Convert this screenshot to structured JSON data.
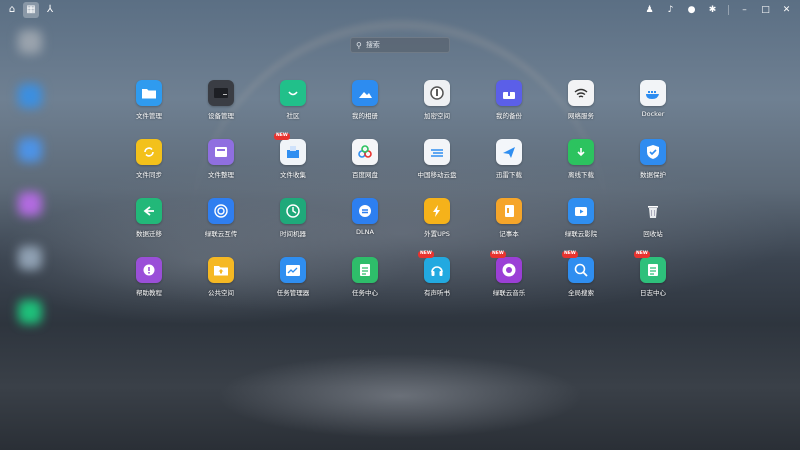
{
  "topbar": {
    "left_buttons": [
      {
        "icon": "home-icon",
        "glyph": "⌂"
      },
      {
        "icon": "grid-icon",
        "glyph": "▦"
      },
      {
        "icon": "network-icon",
        "glyph": "⅄"
      }
    ],
    "right_buttons": [
      {
        "icon": "mic-icon",
        "glyph": "♟"
      },
      {
        "icon": "bell-icon",
        "glyph": "♪"
      },
      {
        "icon": "user-icon",
        "glyph": "●"
      },
      {
        "icon": "gear-icon",
        "glyph": "✱"
      },
      {
        "icon": "minimize-icon",
        "glyph": "–"
      },
      {
        "icon": "maximize-icon",
        "glyph": "□"
      },
      {
        "icon": "close-icon",
        "glyph": "✕"
      }
    ]
  },
  "search": {
    "placeholder": "搜索",
    "icon": "search-icon",
    "glyph": "⚲"
  },
  "apps": [
    {
      "label": "文件管理",
      "icon": "folder-icon",
      "color": "#2f9bef",
      "badge": ""
    },
    {
      "label": "设备管理",
      "icon": "device-icon",
      "color": "#3a3d44",
      "badge": ""
    },
    {
      "label": "社区",
      "icon": "community-icon",
      "color": "#21c08a",
      "badge": ""
    },
    {
      "label": "我的相册",
      "icon": "photo-icon",
      "color": "#2d8cf0",
      "badge": ""
    },
    {
      "label": "加密空间",
      "icon": "safe-icon",
      "color": "#eef0f3",
      "badge": ""
    },
    {
      "label": "我的备份",
      "icon": "backup-icon",
      "color": "#5b5fe8",
      "badge": ""
    },
    {
      "label": "网络服务",
      "icon": "wifi-icon",
      "color": "#f2f3f5",
      "badge": ""
    },
    {
      "label": "Docker",
      "icon": "docker-icon",
      "color": "#f2f4f7",
      "badge": ""
    },
    {
      "label": "文件同步",
      "icon": "sync-icon",
      "color": "#f3c11b",
      "badge": ""
    },
    {
      "label": "文件整理",
      "icon": "organize-icon",
      "color": "#8f6fe0",
      "badge": ""
    },
    {
      "label": "文件收集",
      "icon": "collect-icon",
      "color": "#f0f4f8",
      "badge": "NEW"
    },
    {
      "label": "百度网盘",
      "icon": "baidu-icon",
      "color": "#f5f6f8",
      "badge": ""
    },
    {
      "label": "中国移动云盘",
      "icon": "cloud-icon",
      "color": "#f3f5f8",
      "badge": ""
    },
    {
      "label": "迅雷下载",
      "icon": "thunder-icon",
      "color": "#f3f6fa",
      "badge": ""
    },
    {
      "label": "离线下载",
      "icon": "download-icon",
      "color": "#2cc35f",
      "badge": ""
    },
    {
      "label": "数据保护",
      "icon": "shield-icon",
      "color": "#2f8cf0",
      "badge": ""
    },
    {
      "label": "数据迁移",
      "icon": "migrate-icon",
      "color": "#22b879",
      "badge": ""
    },
    {
      "label": "绿联云互传",
      "icon": "transfer-icon",
      "color": "#2f7ef0",
      "badge": ""
    },
    {
      "label": "时间机器",
      "icon": "clock-icon",
      "color": "#1fa97a",
      "badge": ""
    },
    {
      "label": "DLNA",
      "icon": "dlna-icon",
      "color": "#2d7ff0",
      "badge": ""
    },
    {
      "label": "外置UPS",
      "icon": "ups-icon",
      "color": "#f5b21a",
      "badge": ""
    },
    {
      "label": "记事本",
      "icon": "notepad-icon",
      "color": "#f5a52a",
      "badge": ""
    },
    {
      "label": "绿联云影院",
      "icon": "tv-icon",
      "color": "#2f8ef0",
      "badge": ""
    },
    {
      "label": "回收站",
      "icon": "trash-icon",
      "color": "transparent",
      "badge": ""
    },
    {
      "label": "帮助教程",
      "icon": "help-icon",
      "color": "#9a4fd8",
      "badge": ""
    },
    {
      "label": "公共空间",
      "icon": "public-folder-icon",
      "color": "#f5b823",
      "badge": ""
    },
    {
      "label": "任务管理器",
      "icon": "task-manager-icon",
      "color": "#2f8ef0",
      "badge": ""
    },
    {
      "label": "任务中心",
      "icon": "task-center-icon",
      "color": "#2ebd6a",
      "badge": ""
    },
    {
      "label": "有声听书",
      "icon": "audiobook-icon",
      "color": "#22a9e0",
      "badge": "NEW"
    },
    {
      "label": "绿联云音乐",
      "icon": "music-icon",
      "color": "#9b3fd6",
      "badge": "NEW"
    },
    {
      "label": "全局搜索",
      "icon": "global-search-icon",
      "color": "#2f8ef0",
      "badge": "NEW"
    },
    {
      "label": "日志中心",
      "icon": "log-icon",
      "color": "#2ec07b",
      "badge": "NEW"
    }
  ]
}
